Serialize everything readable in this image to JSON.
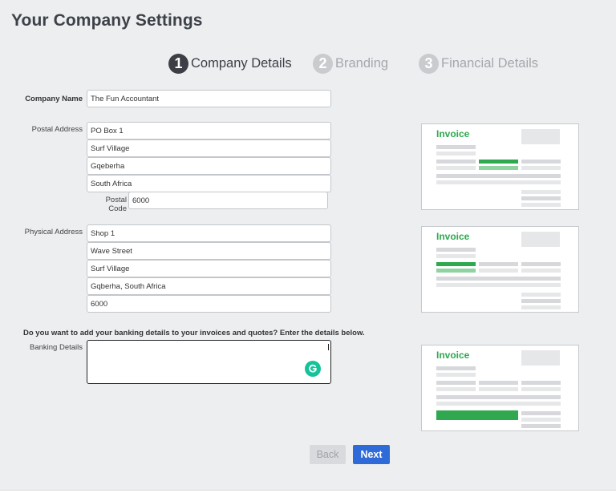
{
  "page": {
    "title": "Your Company Settings"
  },
  "steps": [
    {
      "number": "1",
      "label": "Company Details",
      "state": "active"
    },
    {
      "number": "2",
      "label": "Branding",
      "state": "inactive"
    },
    {
      "number": "3",
      "label": "Financial Details",
      "state": "inactive"
    }
  ],
  "form": {
    "company_name": {
      "label": "Company Name",
      "value": "The Fun Accountant"
    },
    "postal_address": {
      "label": "Postal Address",
      "lines": [
        "PO Box 1",
        "Surf Village",
        "Gqeberha",
        "South Africa"
      ],
      "postal_code_label": "Postal Code",
      "postal_code": "6000"
    },
    "physical_address": {
      "label": "Physical Address",
      "lines": [
        "Shop 1",
        "Wave Street",
        "Surf Village",
        "Gqberha, South Africa",
        "6000"
      ]
    },
    "banking": {
      "prompt": "Do you want to add your banking details to your invoices and quotes? Enter the details below.",
      "label": "Banking Details",
      "value": ""
    }
  },
  "invoice_previews": [
    {
      "title": "Invoice"
    },
    {
      "title": "Invoice"
    },
    {
      "title": "Invoice"
    }
  ],
  "buttons": {
    "back": "Back",
    "next": "Next"
  },
  "colors": {
    "accent_green": "#2fa84f",
    "primary_blue": "#2f6bd8",
    "grammarly_green": "#15c39a",
    "panel_bg": "#eceef0"
  }
}
